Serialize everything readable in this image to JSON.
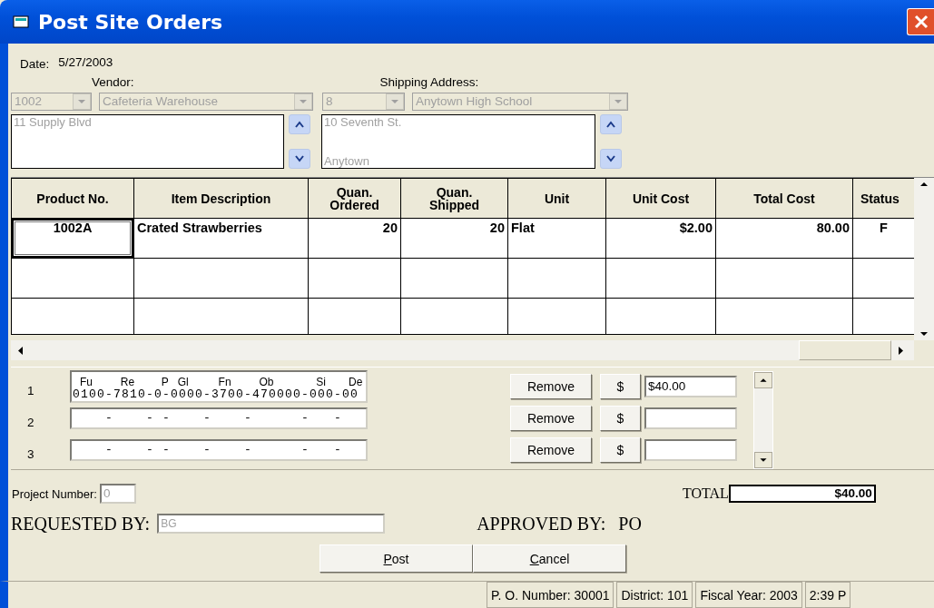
{
  "window": {
    "title": "Post Site Orders"
  },
  "date": {
    "label": "Date:",
    "value": "5/27/2003"
  },
  "vendor": {
    "label": "Vendor:",
    "code": "1002",
    "name": "Cafeteria Warehouse",
    "address": [
      "11 Supply Blvd"
    ],
    "disabled": true
  },
  "shipping_address": {
    "label": "Shipping Address:",
    "code": "8",
    "name": "Anytown High School",
    "address": [
      "10 Seventh St.",
      "Anytown"
    ],
    "disabled": true
  },
  "grid": {
    "columns": [
      "Product No.",
      "Item Description",
      "Quan. Ordered",
      "Quan. Shipped",
      "Unit",
      "Unit Cost",
      "Total Cost",
      "Status"
    ],
    "rows": [
      {
        "cells": [
          {
            "text": "1002A",
            "focused": true
          },
          {
            "text": "Crated Strawberries",
            "focused": false
          },
          {
            "text": "20",
            "focused": false
          },
          {
            "text": "20",
            "focused": false
          },
          {
            "text": "Flat",
            "focused": false
          },
          {
            "text": "$2.00",
            "focused": false
          },
          {
            "text": "80.00",
            "focused": false
          },
          {
            "text": "F",
            "focused": false
          }
        ]
      }
    ]
  },
  "accounts": [
    {
      "number": "1",
      "segment_labels": [
        "Fu",
        "Re",
        "P",
        "Gl",
        "Fn",
        "Ob",
        "Si",
        "De"
      ],
      "account": "0100-7810-0-0000-3700-470000-000-00",
      "remove": "Remove",
      "dollar": "$",
      "amount": "$40.00"
    },
    {
      "number": "2",
      "account": "    -    - -    -    -      -   -",
      "remove": "Remove",
      "dollar": "$"
    },
    {
      "number": "3",
      "account": "    -    - -    -    -      -   -",
      "remove": "Remove",
      "dollar": "$"
    }
  ],
  "project_number": {
    "label": "Project Number:",
    "value": "0",
    "disabled": true
  },
  "total": {
    "label": "TOTAL",
    "value": "$40.00"
  },
  "requested_by": {
    "label": "REQUESTED BY:",
    "value": "BG",
    "disabled": true
  },
  "approved_by": {
    "label": "APPROVED BY:",
    "value": "PO"
  },
  "buttons": [
    {
      "label": "Post",
      "mnemonic": true
    },
    {
      "label": "Cancel",
      "mnemonic": true
    }
  ],
  "status_bar": [
    "P. O. Number: 30001",
    "District: 101",
    "Fiscal Year: 2003",
    "2:39 P"
  ]
}
